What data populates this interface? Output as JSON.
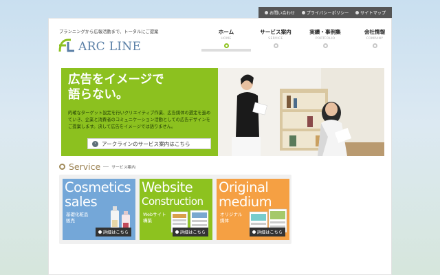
{
  "top_links": [
    {
      "label": "お問い合わせ"
    },
    {
      "label": "プライバシーポリシー"
    },
    {
      "label": "サイトマップ"
    }
  ],
  "header": {
    "tagline": "プランニングから広報活動まで、トータルにご提案",
    "logo_text": "ARC LINE"
  },
  "nav": [
    {
      "label": "ホーム",
      "sub": "HOME"
    },
    {
      "label": "サービス案内",
      "sub": "SERVICE"
    },
    {
      "label": "実績・事例集",
      "sub": "PORTFOLIO"
    },
    {
      "label": "会社情報",
      "sub": "COMPANY"
    }
  ],
  "hero": {
    "title_line1": "広告をイメージで",
    "title_line2": "語らない。",
    "desc": "的確なターゲット設定を行いクリエイティブ作業、広告媒体の選定を進めていき、企業と消費者のコミュニケーション活動としての広告デザインをご提案します。決して広告をイメージでは語りません。",
    "button_label": "アークラインのサービス案内はこちら"
  },
  "service": {
    "title": "Service",
    "subtitle": "サービス案内",
    "cards": [
      {
        "title_line1": "Cosmetics",
        "title_line2": "sales",
        "sub_line1": "基礎化粧品",
        "sub_line2": "販売",
        "button": "詳細はこちら"
      },
      {
        "title_line1": "Website",
        "title_line2": "Construction",
        "sub_line1": "Webサイト",
        "sub_line2": "構築",
        "button": "詳細はこちら"
      },
      {
        "title_line1": "Original",
        "title_line2": "medium",
        "sub_line1": "オリジナル",
        "sub_line2": "媒体",
        "button": "詳細はこちら"
      }
    ]
  },
  "colors": {
    "green": "#8cc11f",
    "blue": "#74a7d8",
    "orange": "#f5a043",
    "logo": "#5a7fa6"
  }
}
